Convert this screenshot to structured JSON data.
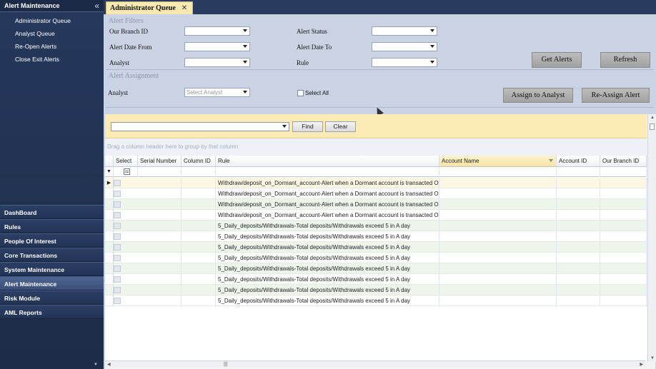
{
  "sidebar": {
    "title": "Alert Maintenance",
    "sub_items": [
      {
        "label": "Administrator Queue"
      },
      {
        "label": "Analyst Queue"
      },
      {
        "label": "Re-Open Alerts"
      },
      {
        "label": "Close Exit Alerts"
      }
    ],
    "nav_items": [
      {
        "label": "DashBoard"
      },
      {
        "label": "Rules"
      },
      {
        "label": "People Of Interest"
      },
      {
        "label": "Core Transactions"
      },
      {
        "label": "System Maintenance"
      },
      {
        "label": "Alert Maintenance",
        "active": true
      },
      {
        "label": "Risk Module"
      },
      {
        "label": "AML Reports"
      }
    ]
  },
  "tab": {
    "label": "Administrator Queue"
  },
  "filters": {
    "section_title": "Alert Filters",
    "branch_label": "Our Branch ID",
    "status_label": "Alert Status",
    "date_from_label": "Alert Date From",
    "date_to_label": "Alert Date To",
    "analyst_label": "Analyst",
    "rule_label": "Rule",
    "get_alerts": "Get Alerts",
    "refresh": "Refresh"
  },
  "assignment": {
    "section_title": "Alert Assignment",
    "analyst_label": "Analyst",
    "analyst_placeholder": "Select Analyst",
    "select_all": "Select All",
    "assign_button": "Assign to Analyst",
    "reassign_button": "Re-Assign Alert"
  },
  "find": {
    "find_button": "Find",
    "clear_button": "Clear"
  },
  "grid": {
    "group_hint": "Drag a column header here to group by that column",
    "columns": [
      {
        "label": "Select"
      },
      {
        "label": "Serial Number"
      },
      {
        "label": "Column ID"
      },
      {
        "label": "Rule"
      },
      {
        "label": "Account Name"
      },
      {
        "label": "Account ID"
      },
      {
        "label": "Our Branch ID"
      }
    ],
    "rows": [
      {
        "rule": "Withdraw/deposit_on_Dormant_account-Alert when a Dormant account is transacted On"
      },
      {
        "rule": "Withdraw/deposit_on_Dormant_account-Alert when a Dormant account is transacted On"
      },
      {
        "rule": "Withdraw/deposit_on_Dormant_account-Alert when a Dormant account is transacted On"
      },
      {
        "rule": "Withdraw/deposit_on_Dormant_account-Alert when a Dormant account is transacted On"
      },
      {
        "rule": "5_Daily_deposits/Withdrawals-Total deposits/Withdrawals exceed 5 in A day"
      },
      {
        "rule": "5_Daily_deposits/Withdrawals-Total deposits/Withdrawals exceed 5 in A day"
      },
      {
        "rule": "5_Daily_deposits/Withdrawals-Total deposits/Withdrawals exceed 5 in A day"
      },
      {
        "rule": "5_Daily_deposits/Withdrawals-Total deposits/Withdrawals exceed 5 in A day"
      },
      {
        "rule": "5_Daily_deposits/Withdrawals-Total deposits/Withdrawals exceed 5 in A day"
      },
      {
        "rule": "5_Daily_deposits/Withdrawals-Total deposits/Withdrawals exceed 5 in A day"
      },
      {
        "rule": "5_Daily_deposits/Withdrawals-Total deposits/Withdrawals exceed 5 in A day"
      },
      {
        "rule": "5_Daily_deposits/Withdrawals-Total deposits/Withdrawals exceed 5 in A day"
      }
    ]
  }
}
